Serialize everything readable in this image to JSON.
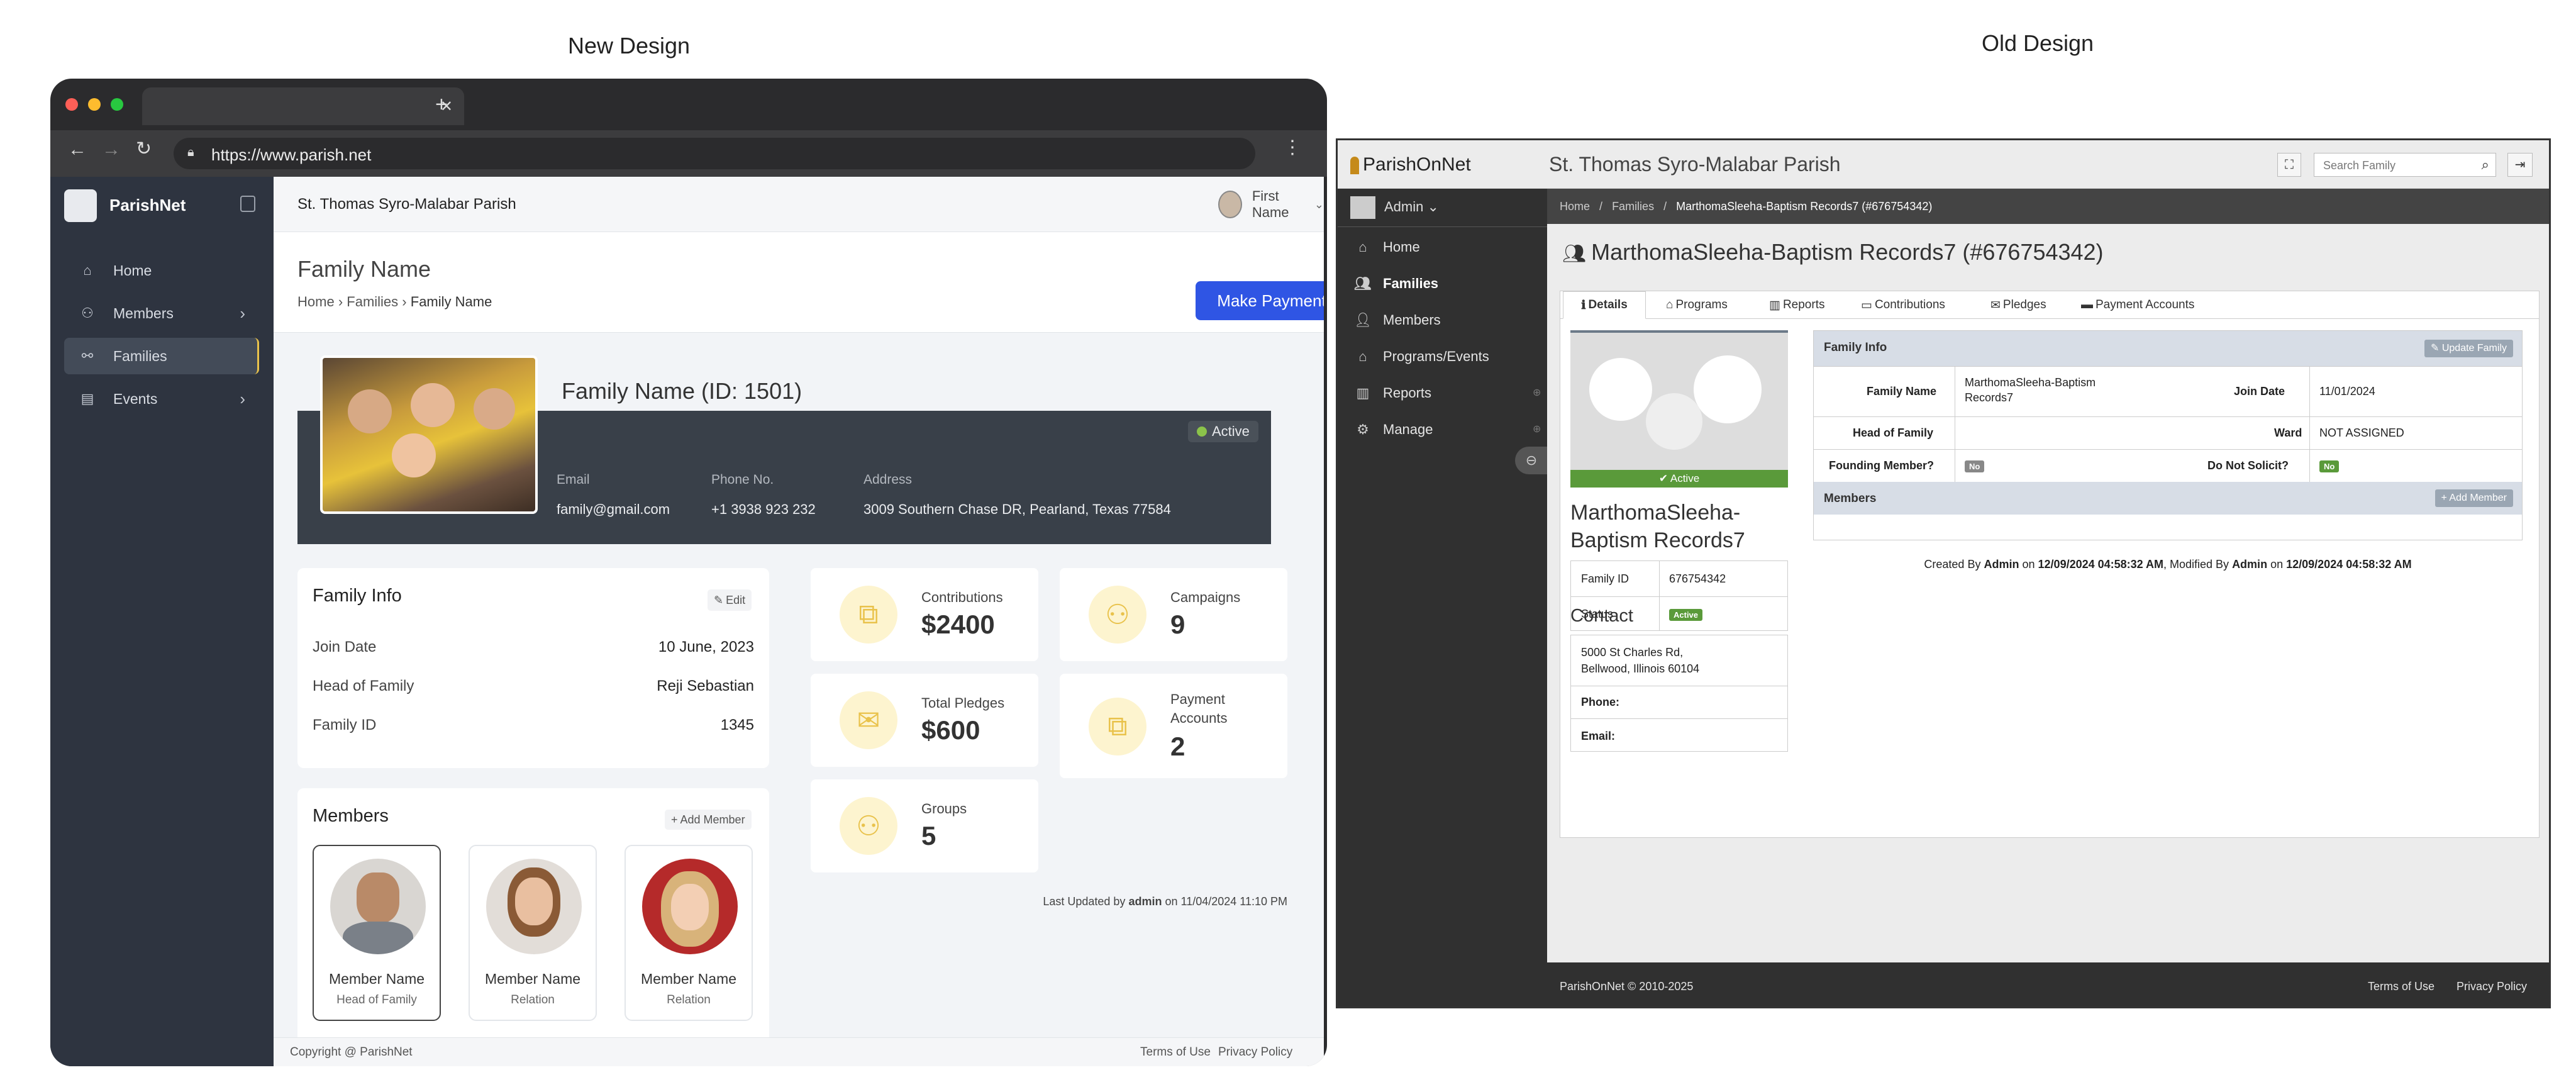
{
  "labels": {
    "new": "New Design",
    "old": "Old Design"
  },
  "browser": {
    "url": "https://www.parish.net",
    "tab_close": "✕",
    "tab_new": "+"
  },
  "app": {
    "name": "ParishNet",
    "parish": "St. Thomas Syro-Malabar Parish",
    "user": "First Name",
    "nav": [
      {
        "label": "Home",
        "icon": "home-icon"
      },
      {
        "label": "Members",
        "icon": "members-icon"
      },
      {
        "label": "Families",
        "icon": "families-icon"
      },
      {
        "label": "Events",
        "icon": "events-icon"
      }
    ],
    "page_title": "Family Name",
    "breadcrumb": [
      "Home",
      "Families",
      "Family Name"
    ],
    "make_payment": "Make Payment",
    "hero": {
      "name": "Family Name (ID: 1501)",
      "status": "Active",
      "email_label": "Email",
      "email": "family@gmail.com",
      "phone_label": "Phone No.",
      "phone": "+1 3938 923 232",
      "address_label": "Address",
      "address": "3009 Southern Chase DR, Pearland, Texas 77584"
    },
    "family_info": {
      "title": "Family Info",
      "edit": "Edit",
      "rows": [
        {
          "label": "Join Date",
          "value": "10 June, 2023"
        },
        {
          "label": "Head of Family",
          "value": "Reji Sebastian"
        },
        {
          "label": "Family ID",
          "value": "1345"
        }
      ]
    },
    "stats": [
      {
        "title": "Contributions",
        "value": "$2400",
        "icon": "documents-icon"
      },
      {
        "title": "Campaigns",
        "value": "9",
        "icon": "people-icon"
      },
      {
        "title": "Total Pledges",
        "value": "$600",
        "icon": "mail-icon"
      },
      {
        "title": "Payment Accounts",
        "value": "2",
        "icon": "documents-icon"
      },
      {
        "title": "Groups",
        "value": "5",
        "icon": "people-icon"
      }
    ],
    "last_updated": {
      "prefix": "Last Updated by",
      "user": "admin",
      "on": "on",
      "date": "11/04/2024 11:10 PM"
    },
    "members": {
      "title": "Members",
      "add": "Add Member",
      "items": [
        {
          "name": "Member Name",
          "role": "Head of Family"
        },
        {
          "name": "Member Name",
          "role": "Relation"
        },
        {
          "name": "Member Name",
          "role": "Relation"
        }
      ]
    },
    "footer": {
      "copyright": "Copyright @ ParishNet",
      "terms": "Terms of Use",
      "privacy": "Privacy Policy"
    }
  },
  "old": {
    "brand": "ParishOnNet",
    "parish": "St. Thomas Syro-Malabar Parish",
    "search_placeholder": "Search Family",
    "user": "Admin",
    "nav": [
      {
        "label": "Home",
        "icon": "home-icon"
      },
      {
        "label": "Families",
        "icon": "families-icon"
      },
      {
        "label": "Members",
        "icon": "member-icon"
      },
      {
        "label": "Programs/Events",
        "icon": "bank-icon"
      },
      {
        "label": "Reports",
        "icon": "chart-icon"
      },
      {
        "label": "Manage",
        "icon": "gear-icon"
      }
    ],
    "breadcrumb": [
      "Home",
      "Families",
      "MarthomaSleeha-Baptism Records7 (#676754342)"
    ],
    "title": "MarthomaSleeha-Baptism Records7 (#676754342)",
    "tabs": [
      "Details",
      "Programs",
      "Reports",
      "Contributions",
      "Pledges",
      "Payment Accounts"
    ],
    "photo_status": "Active",
    "family_name": "MarthomaSleeha-Baptism Records7",
    "family_id_label": "Family ID",
    "family_id": "676754342",
    "status_label": "Status",
    "status": "Active",
    "contact_title": "Contact",
    "address": "5000 St Charles Rd, Bellwood, Illinois 60104",
    "phone_label": "Phone:",
    "email_label": "Email:",
    "info_title": "Family Info",
    "update": "Update Family",
    "info": {
      "family_name_label": "Family Name",
      "family_name": "MarthomaSleeha-Baptism Records7",
      "join_label": "Join Date",
      "join": "11/01/2024",
      "head_label": "Head of Family",
      "ward_label": "Ward",
      "ward": "NOT ASSIGNED",
      "founding_label": "Founding Member?",
      "founding": "No",
      "solicit_label": "Do Not Solicit?",
      "solicit": "No"
    },
    "members_title": "Members",
    "add_member": "Add Member",
    "created": {
      "p1": "Created By",
      "u1": "Admin",
      "p2": "on",
      "d1": "12/09/2024 04:58:32 AM",
      "p3": ", Modified By",
      "u2": "Admin",
      "p4": "on",
      "d2": "12/09/2024 04:58:32 AM"
    },
    "footer": {
      "copyright": "ParishOnNet © 2010-2025",
      "terms": "Terms of Use",
      "privacy": "Privacy Policy"
    }
  }
}
